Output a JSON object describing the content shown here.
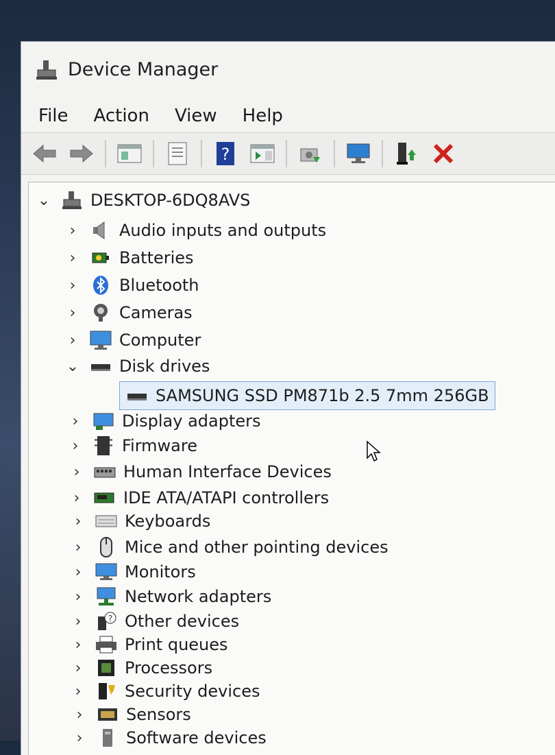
{
  "window": {
    "title": "Device Manager",
    "icon": "device-manager-icon"
  },
  "menu": [
    "File",
    "Action",
    "View",
    "Help"
  ],
  "toolbar": [
    "back-icon",
    "forward-icon",
    "show-hide-console-tree-icon",
    "properties-icon",
    "help-icon",
    "action-pane-icon",
    "scan-hardware-icon",
    "monitor-icon",
    "update-driver-icon",
    "uninstall-device-icon"
  ],
  "tree": {
    "root": "DESKTOP-6DQ8AVS",
    "items": [
      {
        "label": "Audio inputs and outputs",
        "icon": "speaker-icon",
        "expanded": false
      },
      {
        "label": "Batteries",
        "icon": "battery-icon",
        "expanded": false
      },
      {
        "label": "Bluetooth",
        "icon": "bluetooth-icon",
        "expanded": false
      },
      {
        "label": "Cameras",
        "icon": "camera-icon",
        "expanded": false
      },
      {
        "label": "Computer",
        "icon": "computer-icon",
        "expanded": false
      },
      {
        "label": "Disk drives",
        "icon": "disk-drive-icon",
        "expanded": true
      },
      {
        "label": "SAMSUNG SSD PM871b 2.5 7mm 256GB",
        "icon": "disk-drive-icon",
        "child": true,
        "selected": true
      },
      {
        "label": "Display adapters",
        "icon": "display-adapter-icon",
        "expanded": false
      },
      {
        "label": "Firmware",
        "icon": "firmware-icon",
        "expanded": false
      },
      {
        "label": "Human Interface Devices",
        "icon": "hid-icon",
        "expanded": false
      },
      {
        "label": "IDE ATA/ATAPI controllers",
        "icon": "ide-controller-icon",
        "expanded": false
      },
      {
        "label": "Keyboards",
        "icon": "keyboard-icon",
        "expanded": false
      },
      {
        "label": "Mice and other pointing devices",
        "icon": "mouse-icon",
        "expanded": false
      },
      {
        "label": "Monitors",
        "icon": "monitor-icon",
        "expanded": false
      },
      {
        "label": "Network adapters",
        "icon": "network-adapter-icon",
        "expanded": false
      },
      {
        "label": "Other devices",
        "icon": "other-devices-icon",
        "expanded": false
      },
      {
        "label": "Print queues",
        "icon": "printer-icon",
        "expanded": false
      },
      {
        "label": "Processors",
        "icon": "processor-icon",
        "expanded": false
      },
      {
        "label": "Security devices",
        "icon": "security-device-icon",
        "expanded": false
      },
      {
        "label": "Sensors",
        "icon": "sensor-icon",
        "expanded": false
      },
      {
        "label": "Software devices",
        "icon": "software-device-icon",
        "expanded": false
      }
    ]
  },
  "colors": {
    "selection_border": "#7aa7d9",
    "selection_bg": "#e4eef9",
    "uninstall_red": "#d0231e",
    "help_blue": "#1f3f99"
  }
}
